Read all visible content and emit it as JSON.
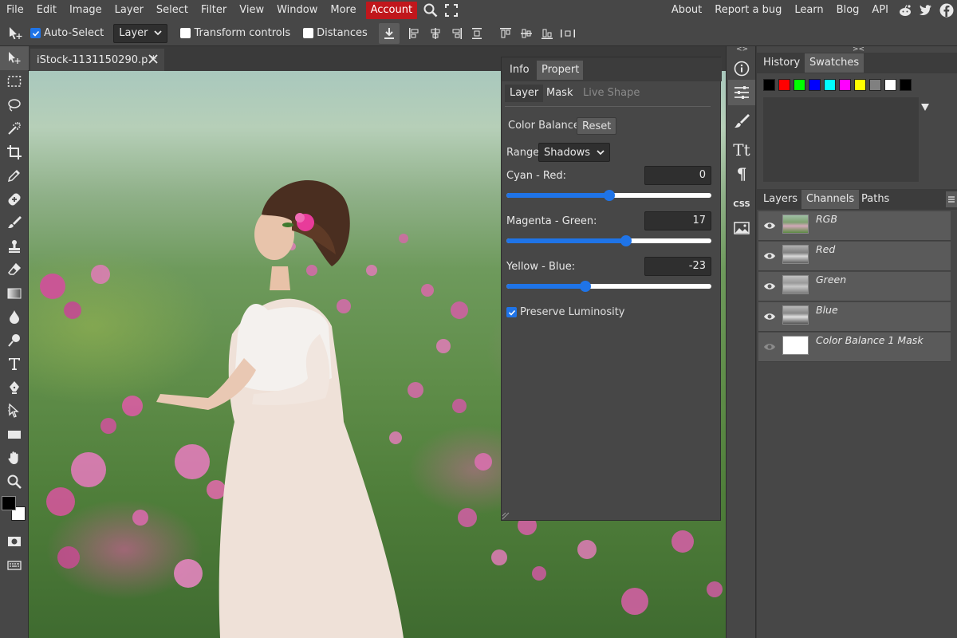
{
  "menu": {
    "items": [
      "File",
      "Edit",
      "Image",
      "Layer",
      "Select",
      "Filter",
      "View",
      "Window",
      "More"
    ],
    "account": "Account",
    "right_links": [
      "About",
      "Report a bug",
      "Learn",
      "Blog",
      "API"
    ]
  },
  "options": {
    "auto_select": "Auto-Select",
    "auto_select_checked": true,
    "layer_select": "Layer",
    "transform_controls": "Transform controls",
    "distances": "Distances"
  },
  "document": {
    "tab_title": "iStock-1131150290.p",
    "modified_mark": "*"
  },
  "properties": {
    "tabs": [
      "Info",
      "Propert"
    ],
    "subtabs": [
      "Layer",
      "Mask",
      "Live Shape"
    ],
    "adjustment": "Color Balance",
    "reset": "Reset",
    "range_label": "Range:",
    "range_value": "Shadows",
    "sliders": [
      {
        "label": "Cyan - Red:",
        "value": "0",
        "fraction": 0.5
      },
      {
        "label": "Magenta - Green:",
        "value": "17",
        "fraction": 0.585
      },
      {
        "label": "Yellow - Blue:",
        "value": "-23",
        "fraction": 0.385
      }
    ],
    "preserve_luminosity": "Preserve Luminosity",
    "preserve_checked": true
  },
  "history_panel": {
    "tabs": [
      "History",
      "Swatches"
    ],
    "swatches": [
      "#000000",
      "#ff0000",
      "#00ff00",
      "#0000ff",
      "#00ffff",
      "#ff00ff",
      "#ffff00",
      "#808080",
      "#ffffff",
      "#000000"
    ]
  },
  "layers_panel": {
    "tabs": [
      "Layers",
      "Channels",
      "Paths"
    ],
    "channels": [
      "RGB",
      "Red",
      "Green",
      "Blue",
      "Color Balance 1 Mask"
    ]
  },
  "colors": {
    "accent": "#1f74e8",
    "account_red": "#c0171c",
    "panel_bg": "#474747",
    "dark_bg": "#3a3a3a"
  }
}
